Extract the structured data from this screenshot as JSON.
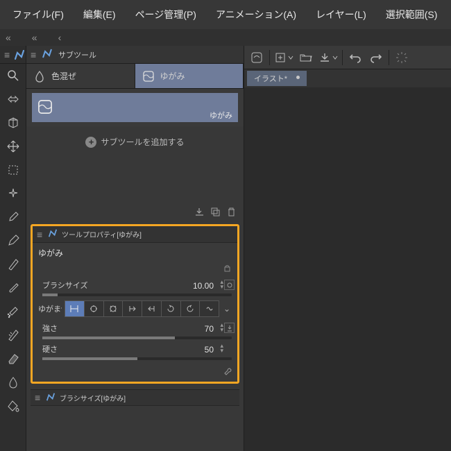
{
  "menu": [
    "ファイル(F)",
    "編集(E)",
    "ページ管理(P)",
    "アニメーション(A)",
    "レイヤー(L)",
    "選択範囲(S)"
  ],
  "subtool": {
    "panel_title": "サブツール",
    "tabs": [
      {
        "label": "色混ぜ",
        "active": false
      },
      {
        "label": "ゆがみ",
        "active": true
      }
    ],
    "item_label": "ゆがみ",
    "add_label": "サブツールを追加する"
  },
  "tool_property": {
    "panel_title": "ツールプロパティ[ゆがみ]",
    "current": "ゆがみ",
    "brush_size": {
      "label": "ブラシサイズ",
      "value": "10.00",
      "pct": 8
    },
    "mode": {
      "label": "ゆがませ方",
      "selected": 0,
      "count": 8
    },
    "strength": {
      "label": "強さ",
      "value": "70",
      "pct": 70
    },
    "hardness": {
      "label": "硬さ",
      "value": "50",
      "pct": 50
    }
  },
  "brush_size_panel": {
    "title": "ブラシサイズ[ゆがみ]"
  },
  "document": {
    "name": "イラスト*"
  },
  "colors": {
    "highlight": "#f5a623",
    "sel": "#5d7db8",
    "tab_active": "#6f7c9a"
  }
}
